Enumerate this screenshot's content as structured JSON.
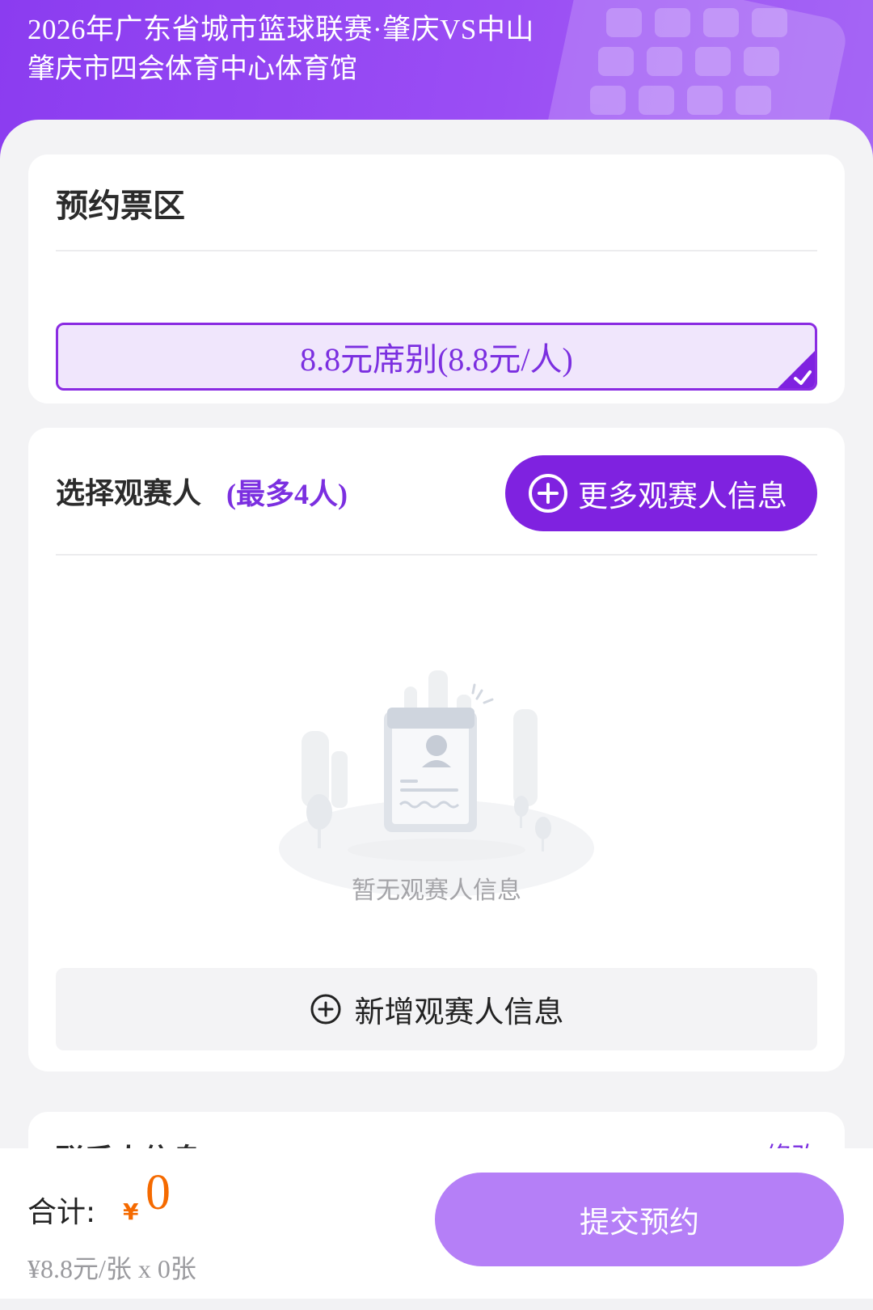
{
  "header": {
    "event_title": "2026年广东省城市篮球联赛·肇庆VS中山",
    "venue": "肇庆市四会体育中心体育馆"
  },
  "zone": {
    "title": "预约票区",
    "selected_option": "8.8元席别(8.8元/人)"
  },
  "viewers": {
    "title": "选择观赛人",
    "limit": "(最多4人)",
    "more_button": "更多观赛人信息",
    "empty_text": "暂无观赛人信息",
    "add_button": "新增观赛人信息"
  },
  "contact": {
    "title": "联系人信息",
    "link": "修改"
  },
  "footer": {
    "total_label": "合计:",
    "currency": "¥",
    "total_value": "0",
    "price_detail": "¥8.8元/张 x 0张",
    "submit_button": "提交预约"
  },
  "colors": {
    "accent": "#7f22e0",
    "accent_light": "#f0e6fc",
    "price": "#f56a00",
    "submit_disabled": "#b57ff7"
  }
}
